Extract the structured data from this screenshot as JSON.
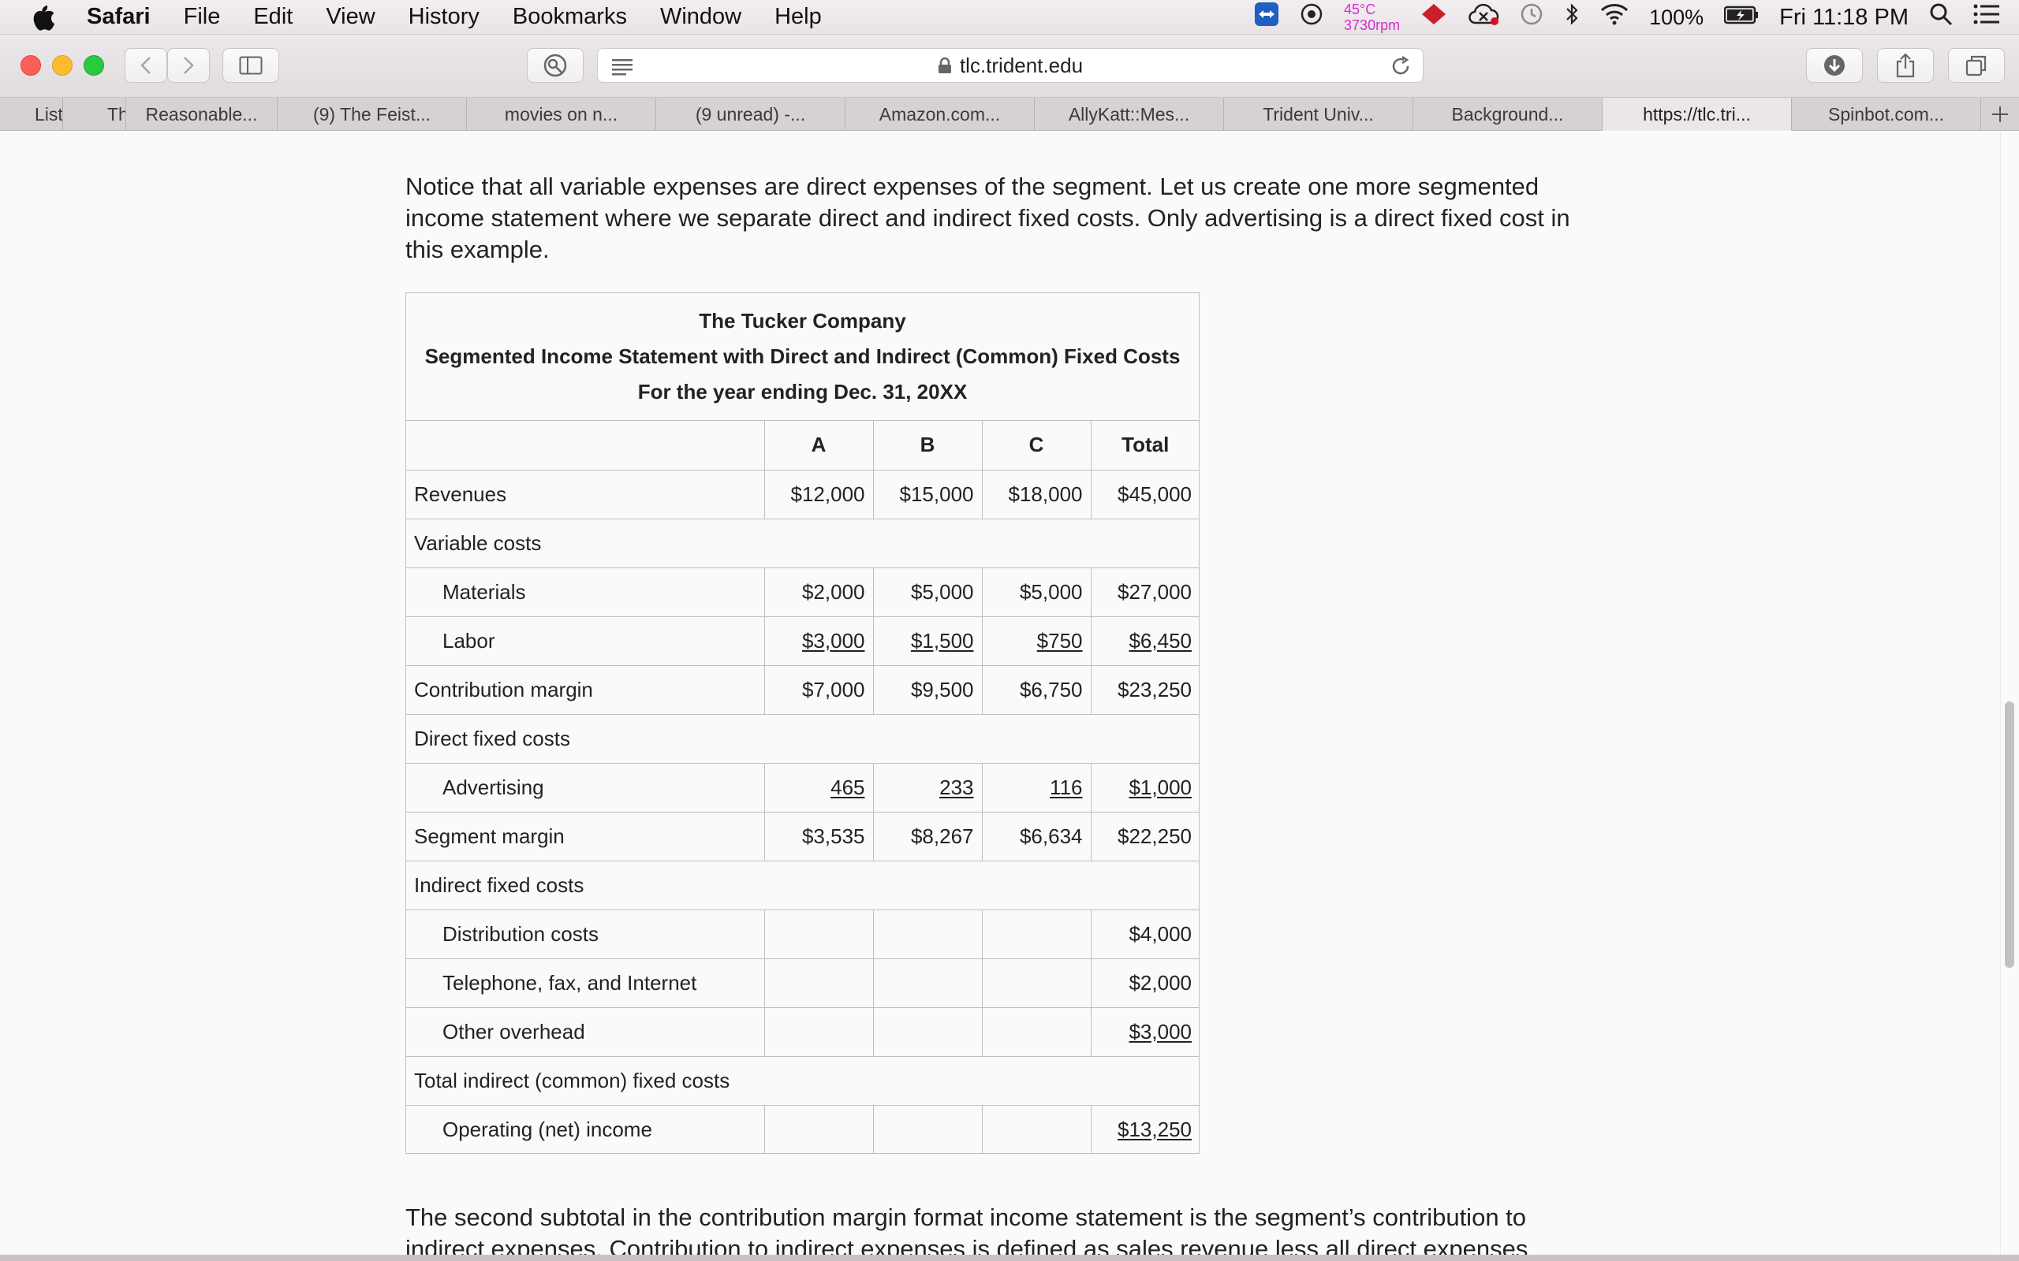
{
  "menubar": {
    "items": [
      "Safari",
      "File",
      "Edit",
      "View",
      "History",
      "Bookmarks",
      "Window",
      "Help"
    ],
    "temperature": "45°C",
    "fan": "3730rpm",
    "battery": "100%",
    "clock": "Fri 11:18 PM"
  },
  "toolbar": {
    "url": "tlc.trident.edu"
  },
  "tabs": [
    {
      "label": "List"
    },
    {
      "label": "Th"
    },
    {
      "label": "Reasonable..."
    },
    {
      "label": "(9) The Feist..."
    },
    {
      "label": "movies on n..."
    },
    {
      "label": "(9 unread) -..."
    },
    {
      "label": "Amazon.com..."
    },
    {
      "label": "AllyKatt::Mes..."
    },
    {
      "label": "Trident Univ..."
    },
    {
      "label": "Background..."
    },
    {
      "label": "https://tlc.tri..."
    },
    {
      "label": "Spinbot.com..."
    }
  ],
  "page": {
    "intro": "Notice that all variable expenses are direct expenses of the segment. Let us create one more segmented income statement where we separate direct and indirect fixed costs. Only advertising is a direct fixed cost in this example.",
    "table": {
      "title1": "The Tucker Company",
      "title2": "Segmented Income Statement with Direct and Indirect (Common) Fixed Costs",
      "title3": "For the year ending Dec. 31, 20XX",
      "columns": [
        "",
        "A",
        "B",
        "C",
        "Total"
      ],
      "rows": [
        {
          "label": "Revenues",
          "a": "$12,000",
          "b": "$15,000",
          "c": "$18,000",
          "total": "$45,000"
        },
        {
          "label": "Variable costs"
        },
        {
          "label": "Materials",
          "a": "$2,000",
          "b": "$5,000",
          "c": "$5,000",
          "total": "$27,000"
        },
        {
          "label": "Labor",
          "a": "$3,000",
          "b": "$1,500",
          "c": "$750",
          "total": "$6,450"
        },
        {
          "label": "Contribution margin",
          "a": "$7,000",
          "b": "$9,500",
          "c": "$6,750",
          "total": "$23,250"
        },
        {
          "label": "Direct fixed costs"
        },
        {
          "label": "Advertising",
          "a": "465",
          "b": "233",
          "c": "116",
          "total": "$1,000"
        },
        {
          "label": "Segment margin",
          "a": "$3,535",
          "b": "$8,267",
          "c": "$6,634",
          "total": "$22,250"
        },
        {
          "label": "Indirect fixed costs"
        },
        {
          "label": "Distribution costs",
          "total": "$4,000"
        },
        {
          "label": "Telephone, fax, and Internet",
          "total": "$2,000"
        },
        {
          "label": "Other overhead",
          "total": "$3,000"
        },
        {
          "label": "Total indirect (common) fixed costs"
        },
        {
          "label": "Operating (net) income",
          "total": "$13,250"
        }
      ]
    },
    "outro": "The second subtotal in the contribution margin format income statement is the segment’s contribution to indirect expenses. Contribution to indirect expenses is defined as sales revenue less all direct expenses"
  }
}
